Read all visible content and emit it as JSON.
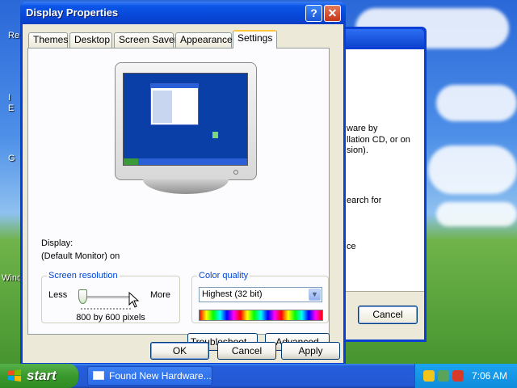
{
  "dialog": {
    "title": "Display Properties",
    "help_button": "?",
    "close_button": "✕",
    "tabs": [
      "Themes",
      "Desktop",
      "Screen Saver",
      "Appearance",
      "Settings"
    ],
    "active_tab": "Settings",
    "display_label": "Display:",
    "display_value": "(Default Monitor) on",
    "screen_resolution": {
      "legend": "Screen resolution",
      "less": "Less",
      "more": "More",
      "value": "800 by 600 pixels",
      "slider_level": 0.0
    },
    "color_quality": {
      "legend": "Color quality",
      "selected": "Highest (32 bit)"
    },
    "buttons": {
      "troubleshoot": "Troubleshoot...",
      "advanced": "Advanced",
      "ok": "OK",
      "cancel": "Cancel",
      "apply": "Apply"
    }
  },
  "background_window": {
    "text_lines": [
      "ware by",
      "llation CD, or on",
      "sion).",
      "earch for",
      "ce"
    ],
    "cancel": "Cancel"
  },
  "desktop_labels": [
    "Re",
    "I",
    "E",
    "G",
    "Wind"
  ],
  "taskbar": {
    "start": "start",
    "task_item": "Found New Hardware...",
    "clock": "7:06 AM"
  },
  "colors": {
    "xp_blue": "#0a3fd6",
    "dialog_bg": "#ece9d8",
    "legend_blue": "#0046d5",
    "start_green": "#3a9a2e",
    "tab_highlight": "#ffc83c"
  }
}
